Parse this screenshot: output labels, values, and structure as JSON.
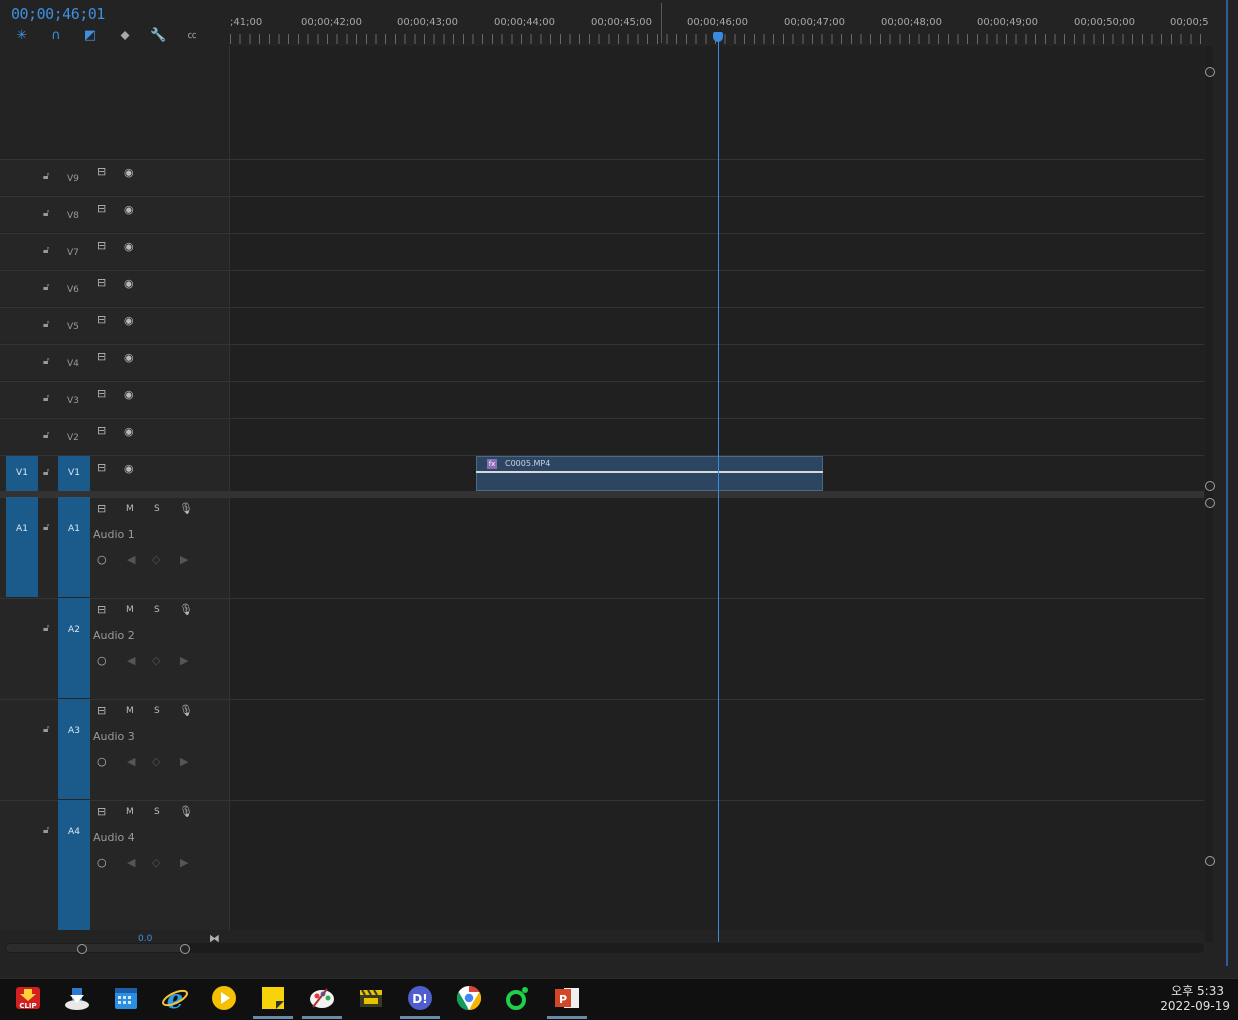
{
  "timecode": "00;00;46;01",
  "ruler_labels": [
    ";41;00",
    "00;00;42;00",
    "00;00;43;00",
    "00;00;44;00",
    "00;00;45;00",
    "00;00;46;00",
    "00;00;47;00",
    "00;00;48;00",
    "00;00;49;00",
    "00;00;50;00",
    "00;00;5"
  ],
  "video_tracks": [
    {
      "name": "V9"
    },
    {
      "name": "V8"
    },
    {
      "name": "V7"
    },
    {
      "name": "V6"
    },
    {
      "name": "V5"
    },
    {
      "name": "V4"
    },
    {
      "name": "V3"
    },
    {
      "name": "V2"
    },
    {
      "name": "V1",
      "source": "V1"
    }
  ],
  "audio_tracks": [
    {
      "name": "A1",
      "label": "Audio 1",
      "source": "A1"
    },
    {
      "name": "A2",
      "label": "Audio 2"
    },
    {
      "name": "A3",
      "label": "Audio 3"
    },
    {
      "name": "A4",
      "label": "Audio 4"
    }
  ],
  "audio_buttons": {
    "mute": "M",
    "solo": "S"
  },
  "clip": {
    "name": "C0005.MP4",
    "fx_badge": "fx"
  },
  "bottom_value": "0.0",
  "clock": {
    "time": "오후 5:33",
    "date": "2022-09-19"
  },
  "taskbar_apps": [
    "clip-downloader",
    "installer",
    "calendar",
    "internet-explorer",
    "media-player",
    "sticky-notes",
    "paint",
    "video-editor",
    "d-app",
    "chrome",
    "naver-app",
    "powerpoint"
  ],
  "accent_color": "#3a8ae0"
}
